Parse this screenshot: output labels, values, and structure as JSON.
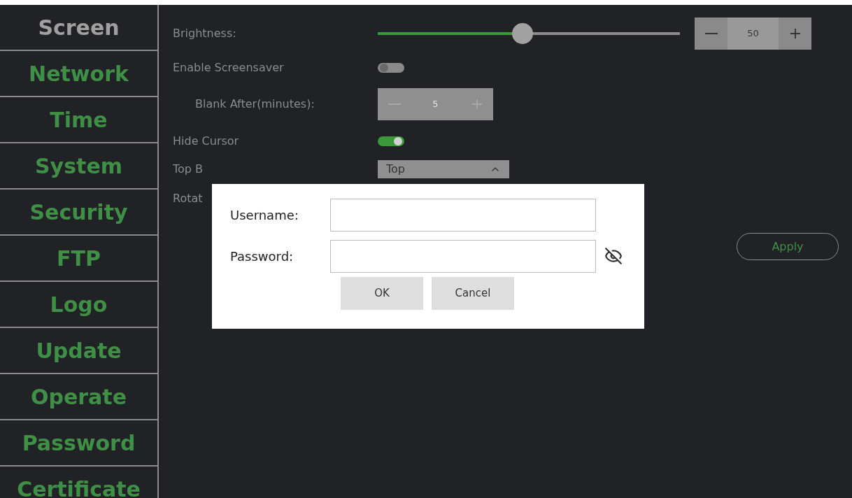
{
  "sidebar": {
    "items": [
      {
        "label": "Screen",
        "selected": true
      },
      {
        "label": "Network",
        "selected": false
      },
      {
        "label": "Time",
        "selected": false
      },
      {
        "label": "System",
        "selected": false
      },
      {
        "label": "Security",
        "selected": false
      },
      {
        "label": "FTP",
        "selected": false
      },
      {
        "label": "Logo",
        "selected": false
      },
      {
        "label": "Update",
        "selected": false
      },
      {
        "label": "Operate",
        "selected": false
      },
      {
        "label": "Password",
        "selected": false
      },
      {
        "label": "Certificate",
        "selected": false
      }
    ]
  },
  "settings": {
    "brightness": {
      "label": "Brightness:",
      "level": 0.48,
      "value": "50"
    },
    "screensaver": {
      "label": "Enable Screensaver",
      "on": false
    },
    "blank_after": {
      "label": "Blank After(minutes):",
      "value": "5",
      "disabled": true
    },
    "hide_cursor": {
      "label": "Hide Cursor",
      "on": true
    },
    "top_bar_position": {
      "label": "Top B",
      "value": "Top"
    },
    "rotation": {
      "label": "Rotat"
    },
    "apply_button": "Apply"
  },
  "dialog": {
    "username": {
      "label": "Username:"
    },
    "password": {
      "label": "Password:"
    },
    "buttons": [
      "OK",
      "Cancel"
    ]
  }
}
